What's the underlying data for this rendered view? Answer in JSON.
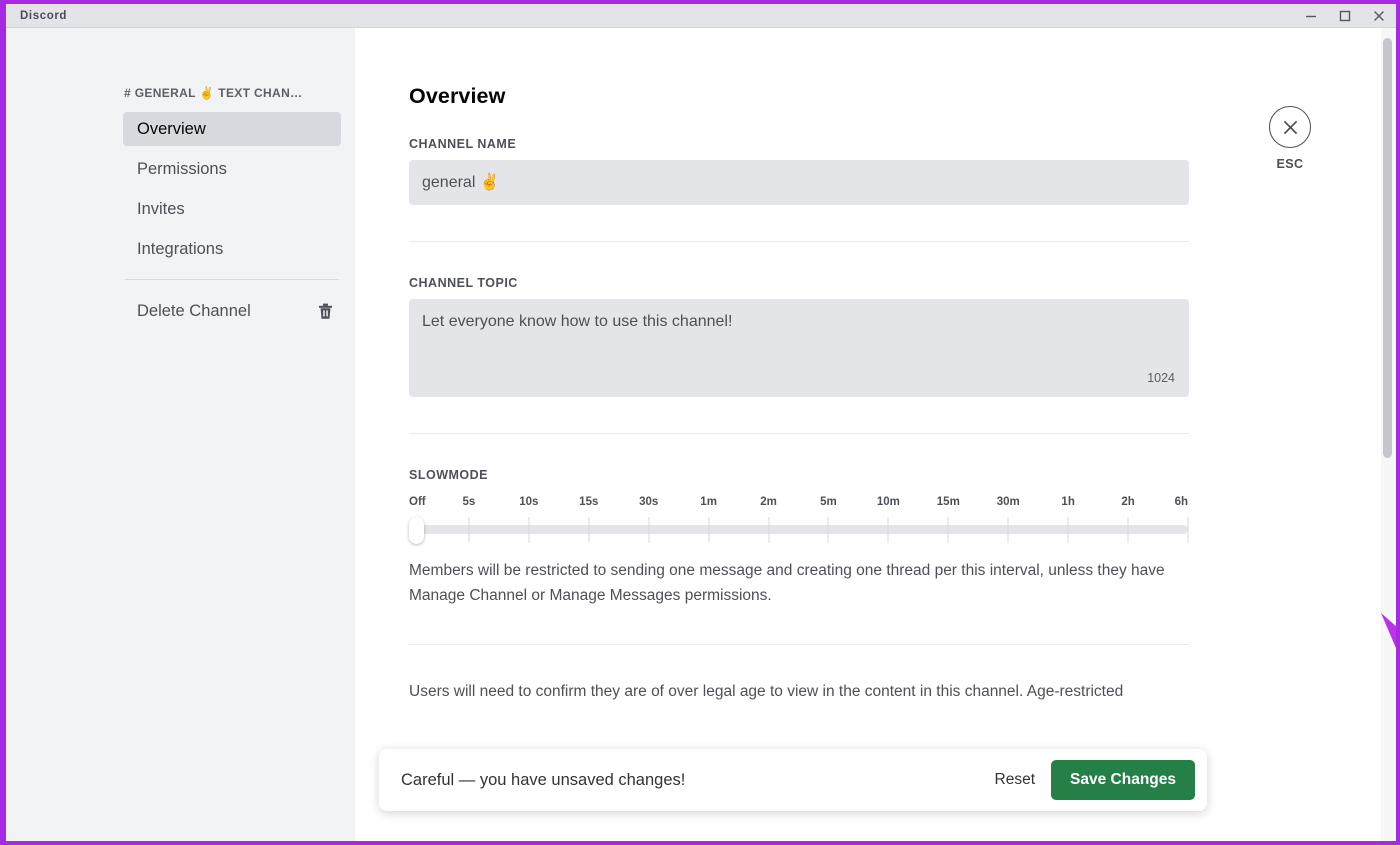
{
  "window": {
    "title": "Discord",
    "border_color": "#a52ae0",
    "controls": [
      {
        "name": "minimize",
        "glyph": "minimize-icon"
      },
      {
        "name": "maximize",
        "glyph": "maximize-icon"
      },
      {
        "name": "close",
        "glyph": "close-icon"
      }
    ]
  },
  "sidebar": {
    "header": "# GENERAL ✌️  TEXT CHAN…",
    "items": [
      {
        "label": "Overview",
        "selected": true
      },
      {
        "label": "Permissions",
        "selected": false
      },
      {
        "label": "Invites",
        "selected": false
      },
      {
        "label": "Integrations",
        "selected": false
      }
    ],
    "delete_channel": {
      "label": "Delete Channel",
      "icon": "trash-icon"
    }
  },
  "main": {
    "title": "Overview",
    "channel_name": {
      "label": "CHANNEL NAME",
      "value": "general ✌️"
    },
    "channel_topic": {
      "label": "CHANNEL TOPIC",
      "value": "Let everyone know how to use this channel!",
      "counter": "1024"
    },
    "slowmode": {
      "label": "SLOWMODE",
      "ticks": [
        "Off",
        "5s",
        "10s",
        "15s",
        "30s",
        "1m",
        "2m",
        "5m",
        "10m",
        "15m",
        "30m",
        "1h",
        "2h",
        "6h"
      ],
      "selected_index": 0,
      "selected_value": "Off",
      "description": "Members will be restricted to sending one message and creating one thread per this interval, unless they have Manage Channel or Manage Messages permissions."
    },
    "age_restricted": {
      "description": "Users will need to confirm they are of over legal age to view in the content in this channel. Age-restricted"
    }
  },
  "esc": {
    "icon": "close-x-icon",
    "label": "ESC"
  },
  "unsaved_bar": {
    "message": "Careful — you have unsaved changes!",
    "reset_label": "Reset",
    "save_label": "Save Changes",
    "save_color": "#248046"
  },
  "annotation": {
    "color": "#bb32e8",
    "points_to": "Save Changes"
  }
}
